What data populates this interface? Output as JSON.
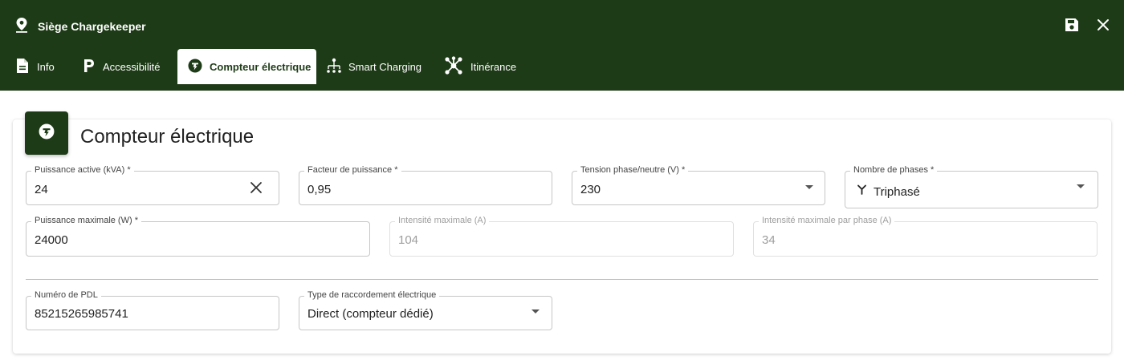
{
  "header": {
    "title": "Siège Chargekeeper",
    "icons": {
      "location": "location-pin-icon",
      "save": "save-icon",
      "close": "close-icon"
    }
  },
  "tabs": [
    {
      "label": "Info",
      "icon": "document-icon",
      "active": false
    },
    {
      "label": "Accessibilité",
      "icon": "parking-icon",
      "active": false
    },
    {
      "label": "Compteur électrique",
      "icon": "meter-icon",
      "active": true
    },
    {
      "label": "Smart Charging",
      "icon": "hierarchy-icon",
      "active": false
    },
    {
      "label": "Itinérance",
      "icon": "network-icon",
      "active": false
    }
  ],
  "card": {
    "title": "Compteur électrique",
    "icon": "meter-icon"
  },
  "fields": {
    "puissance_active": {
      "label": "Puissance active (kVA) *",
      "value": "24"
    },
    "facteur_puissance": {
      "label": "Facteur de puissance *",
      "value": "0,95"
    },
    "tension": {
      "label": "Tension phase/neutre (V) *",
      "value": "230"
    },
    "phases": {
      "label": "Nombre de phases *",
      "value": "Triphasé",
      "icon": "three-phase-icon"
    },
    "puissance_max": {
      "label": "Puissance maximale (W) *",
      "value": "24000"
    },
    "intensite_max": {
      "label": "Intensité maximale (A)",
      "value": "104",
      "disabled": true
    },
    "intensite_phase": {
      "label": "Intensité maximale par phase (A)",
      "value": "34",
      "disabled": true
    },
    "pdl": {
      "label": "Numéro de PDL",
      "value": "85215265985741"
    },
    "raccordement": {
      "label": "Type de raccordement électrique",
      "value": "Direct (compteur dédié)"
    }
  },
  "colors": {
    "brand": "#1e3b17",
    "header_text": "#ffffff",
    "border": "#c7c7c7",
    "disabled_text": "#9e9e9e"
  }
}
